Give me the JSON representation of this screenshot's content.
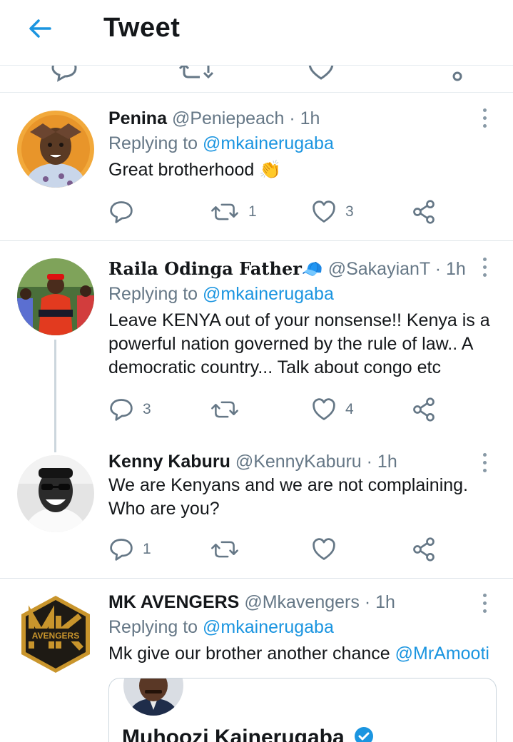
{
  "header": {
    "title": "Tweet"
  },
  "tweets": [
    {
      "name": "Penina",
      "handle": "@Peniepeach",
      "time": "· 1h",
      "reply_prefix": "Replying to",
      "reply_to": "@mkainerugaba",
      "text": "Great brotherhood 👏",
      "replies": "",
      "retweets": "1",
      "likes": "3"
    },
    {
      "name": "Raila Odinga Father🧢",
      "handle": "@SakayianT",
      "time": "· 1h",
      "reply_prefix": "Replying to",
      "reply_to": "@mkainerugaba",
      "text": "Leave KENYA out of your nonsense!!  Kenya is a powerful nation governed by the rule of law..  A democratic country... Talk about congo etc",
      "replies": "3",
      "retweets": "",
      "likes": "4"
    },
    {
      "name": "Kenny Kaburu",
      "handle": "@KennyKaburu",
      "time": "· 1h",
      "text": "We are Kenyans and we are not complaining. Who are you?",
      "replies": "1",
      "retweets": "",
      "likes": ""
    },
    {
      "name": "MK AVENGERS",
      "handle": "@Mkavengers",
      "time": "· 1h",
      "reply_prefix": "Replying to",
      "reply_to": "@mkainerugaba",
      "text": "Mk give our brother another chance",
      "mention": "@MrAmooti",
      "avatar_logo_text": "AVENGERS",
      "quote_name": "Muhoozi Kainerugaba"
    }
  ],
  "colors": {
    "accent": "#1b95e0",
    "secondary_text": "#657786",
    "icon": "#657786",
    "divider": "#dde3e8"
  }
}
